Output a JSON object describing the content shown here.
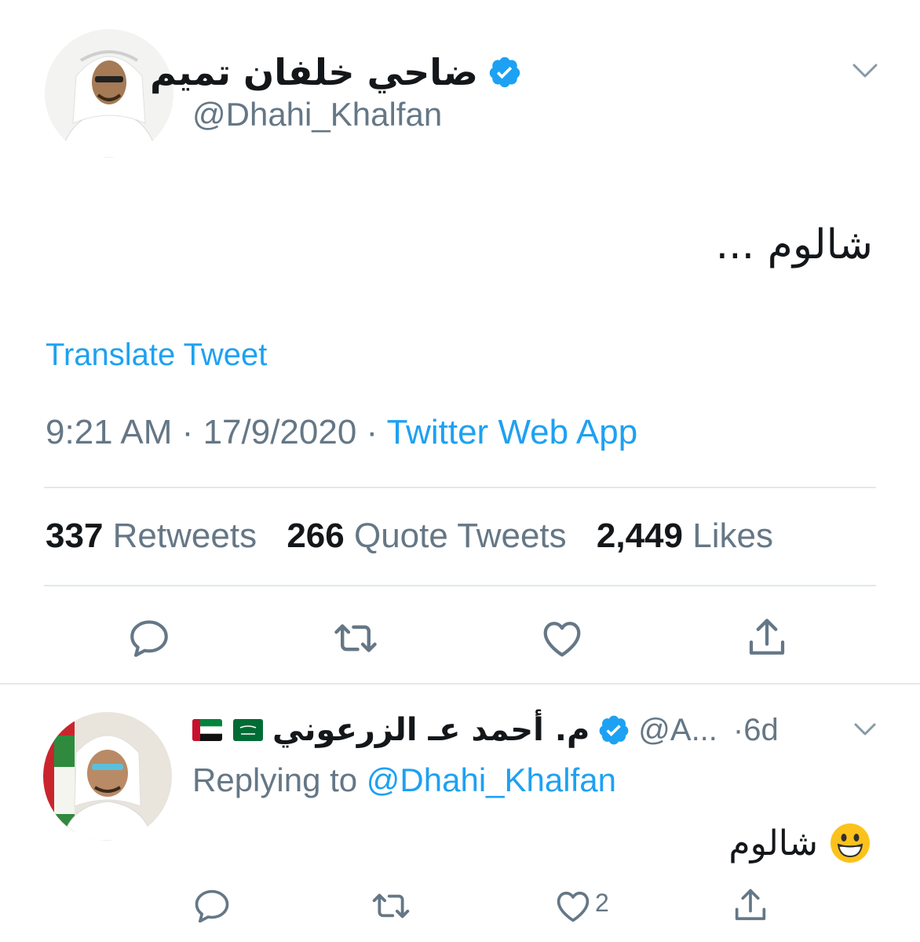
{
  "tweet": {
    "author_name": "ضاحي خلفان تميم",
    "author_handle": "@Dhahi_Khalfan",
    "text": "شالوم ...",
    "translate_label": "Translate Tweet",
    "time": "9:21 AM",
    "date": "17/9/2020",
    "separator": "·",
    "source": "Twitter Web App",
    "stats": {
      "retweets_count": "337",
      "retweets_label": "Retweets",
      "quotes_count": "266",
      "quotes_label": "Quote Tweets",
      "likes_count": "2,449",
      "likes_label": "Likes"
    }
  },
  "reply": {
    "author_name": "م. أحمد عـ الزرعوني",
    "author_handle": "@A...",
    "time": "·6d",
    "replying_prefix": "Replying to",
    "replying_to": "@Dhahi_Khalfan",
    "text": "شالوم",
    "like_count": "2",
    "emoji": "grinning-face-emoji"
  },
  "colors": {
    "accent": "#1da1f2",
    "secondary_text": "#657786",
    "primary_text": "#14171a",
    "divider": "#e1e8ed"
  },
  "icons": [
    "verified-badge-icon",
    "chevron-down-icon",
    "reply-icon",
    "retweet-icon",
    "like-icon",
    "share-icon",
    "uae-flag-icon",
    "saudi-flag-icon"
  ]
}
